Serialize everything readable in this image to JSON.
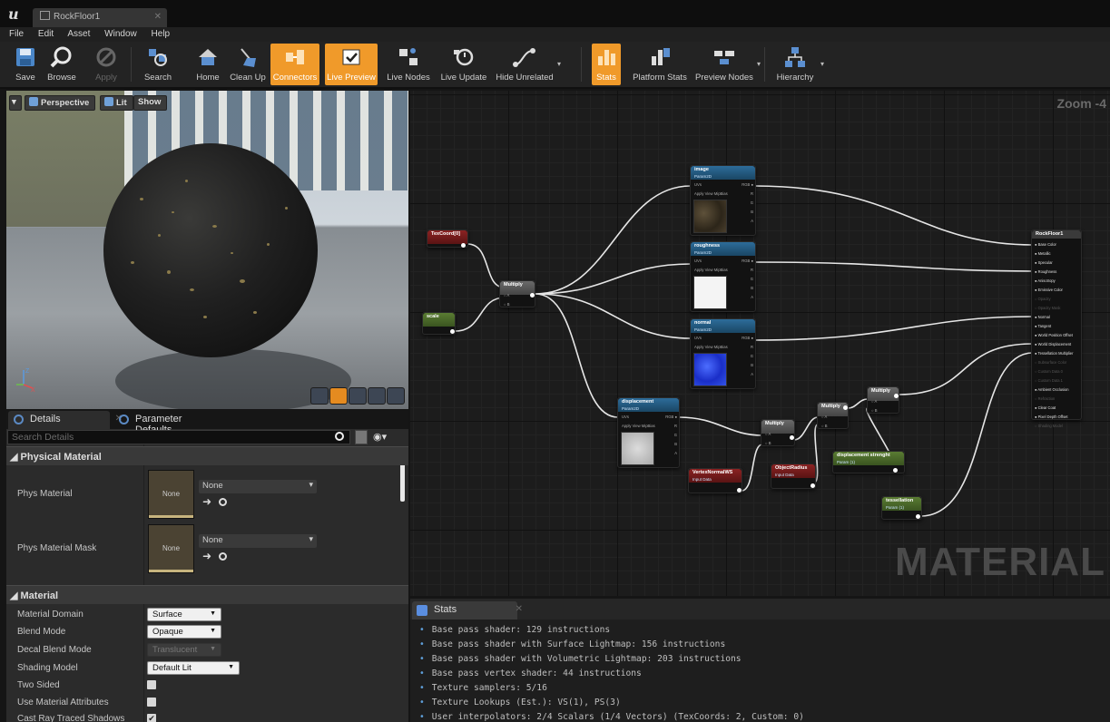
{
  "window": {
    "doc_tab": "RockFloor1"
  },
  "menu": [
    "File",
    "Edit",
    "Asset",
    "Window",
    "Help"
  ],
  "toolbar": [
    {
      "id": "save",
      "label": "Save",
      "state": "normal"
    },
    {
      "id": "browse",
      "label": "Browse",
      "state": "normal"
    },
    {
      "id": "apply",
      "label": "Apply",
      "state": "disabled"
    },
    {
      "id": "search",
      "label": "Search",
      "state": "normal"
    },
    {
      "id": "home",
      "label": "Home",
      "state": "normal"
    },
    {
      "id": "cleanup",
      "label": "Clean Up",
      "state": "normal"
    },
    {
      "id": "connectors",
      "label": "Connectors",
      "state": "active"
    },
    {
      "id": "livepreview",
      "label": "Live Preview",
      "state": "active"
    },
    {
      "id": "livenodes",
      "label": "Live Nodes",
      "state": "normal"
    },
    {
      "id": "liveupdate",
      "label": "Live Update",
      "state": "normal"
    },
    {
      "id": "hideunrelated",
      "label": "Hide Unrelated",
      "state": "normal"
    },
    {
      "id": "stats",
      "label": "Stats",
      "state": "active"
    },
    {
      "id": "platformstats",
      "label": "Platform Stats",
      "state": "normal"
    },
    {
      "id": "previewnodes",
      "label": "Preview Nodes",
      "state": "normal"
    },
    {
      "id": "hierarchy",
      "label": "Hierarchy",
      "state": "normal"
    }
  ],
  "viewport": {
    "perspective": "Perspective",
    "lit": "Lit",
    "show": "Show"
  },
  "details": {
    "tab_details": "Details",
    "tab_params": "Parameter Defaults",
    "search_placeholder": "Search Details",
    "physical_material": {
      "title": "Physical Material",
      "phys_material": {
        "label": "Phys Material",
        "thumb": "None",
        "value": "None"
      },
      "phys_material_mask": {
        "label": "Phys Material Mask",
        "thumb": "None",
        "value": "None"
      }
    },
    "material": {
      "title": "Material",
      "material_domain": {
        "label": "Material Domain",
        "value": "Surface"
      },
      "blend_mode": {
        "label": "Blend Mode",
        "value": "Opaque"
      },
      "decal_blend_mode": {
        "label": "Decal Blend Mode",
        "value": "Translucent"
      },
      "shading_model": {
        "label": "Shading Model",
        "value": "Default Lit"
      },
      "two_sided": {
        "label": "Two Sided",
        "checked": false
      },
      "use_material_attributes": {
        "label": "Use Material Attributes",
        "checked": false
      },
      "cast_ray_traced_shadows": {
        "label": "Cast Ray Traced Shadows",
        "checked": true
      }
    }
  },
  "graph": {
    "zoom": "Zoom -4",
    "watermark": "MATERIAL",
    "nodes": {
      "texcoord": "TexCoord[0]",
      "scale": "scale",
      "multiply1": "Multiply",
      "image": "image",
      "roughness": "roughness",
      "normal": "normal",
      "displacement": "displacement",
      "param2d": "Param2D",
      "vertex_normal": "VertexNormalWS",
      "object_radius": "ObjectRadius",
      "input_data": "Input Data",
      "multiply2": "Multiply",
      "multiply3": "Multiply",
      "multiply4": "Multiply",
      "displacement_strength": "displacement strenght",
      "tessellation": "tessellation",
      "param": "Param (1)",
      "result": "RockFloor1"
    },
    "sample_inputs": [
      "UVs",
      "Apply View MipBias"
    ],
    "sample_outputs": [
      "RGB",
      "R",
      "G",
      "B",
      "A",
      "RGBA"
    ],
    "result_inputs": [
      "Base Color",
      "Metallic",
      "Specular",
      "Roughness",
      "Anisotropy",
      "Emissive Color",
      "Opacity",
      "Opacity Mask",
      "Normal",
      "Tangent",
      "World Position Offset",
      "World Displacement",
      "Tessellation Multiplier",
      "Subsurface Color",
      "Custom Data 0",
      "Custom Data 1",
      "Ambient Occlusion",
      "Refraction",
      "Clear Coat",
      "Pixel Depth Offset",
      "Shading Model"
    ]
  },
  "stats": {
    "tab": "Stats",
    "lines": [
      "Base pass shader: 129 instructions",
      "Base pass shader with Surface Lightmap: 156 instructions",
      "Base pass shader with Volumetric Lightmap: 203 instructions",
      "Base pass vertex shader: 44 instructions",
      "Texture samplers: 5/16",
      "Texture Lookups (Est.): VS(1), PS(3)",
      "User interpolators: 2/4 Scalars (1/4 Vectors) (TexCoords: 2, Custom: 0)"
    ]
  },
  "colors": {
    "accent": "#f09a2a",
    "texture_node": "#2d6c9a",
    "vector_node": "#8b2323",
    "scalar_node": "#5a7c33"
  }
}
